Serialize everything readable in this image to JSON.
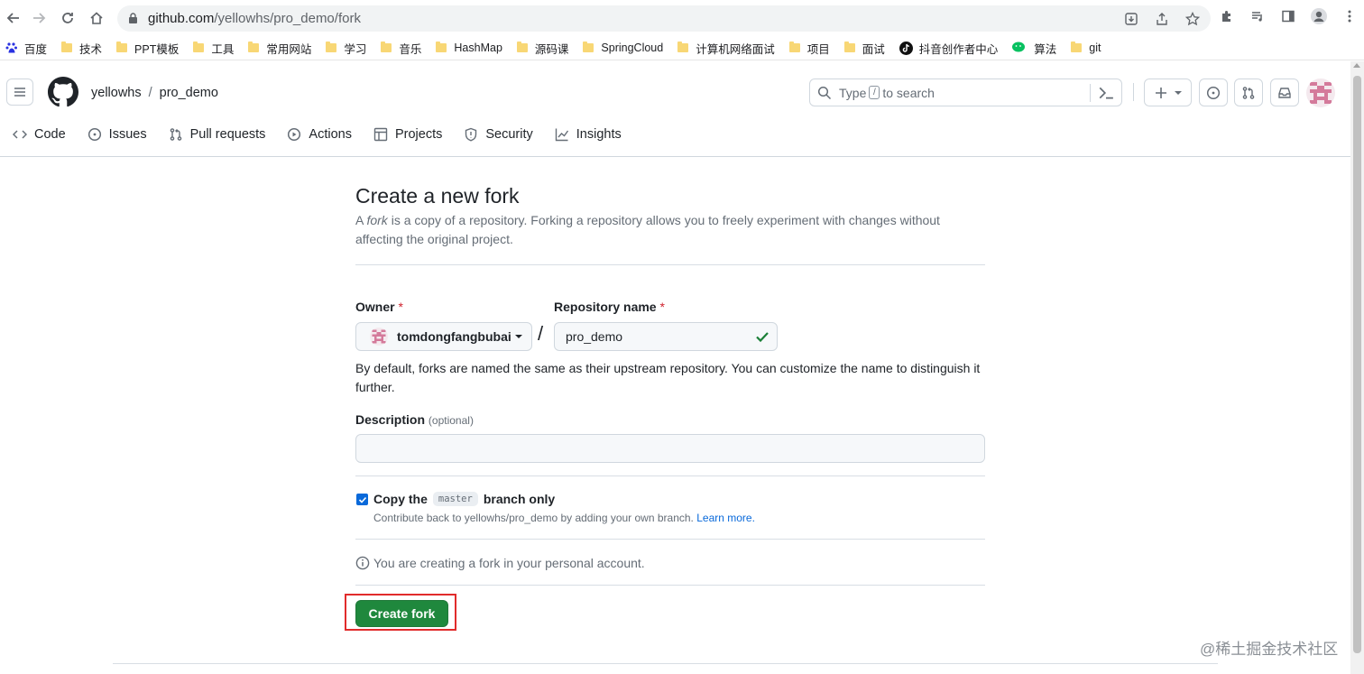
{
  "browser": {
    "url_host": "github.com",
    "url_path": "/yellowhs/pro_demo/fork",
    "bookmarks": [
      {
        "label": "百度",
        "icon": "baidu-icon"
      },
      {
        "label": "技术",
        "icon": "folder-icon"
      },
      {
        "label": "PPT模板",
        "icon": "folder-icon"
      },
      {
        "label": "工具",
        "icon": "folder-icon"
      },
      {
        "label": "常用网站",
        "icon": "folder-icon"
      },
      {
        "label": "学习",
        "icon": "folder-icon"
      },
      {
        "label": "音乐",
        "icon": "folder-icon"
      },
      {
        "label": "HashMap",
        "icon": "folder-icon"
      },
      {
        "label": "源码课",
        "icon": "folder-icon"
      },
      {
        "label": "SpringCloud",
        "icon": "folder-icon"
      },
      {
        "label": "计算机网络面试",
        "icon": "folder-icon"
      },
      {
        "label": "项目",
        "icon": "folder-icon"
      },
      {
        "label": "面试",
        "icon": "folder-icon"
      },
      {
        "label": "抖音创作者中心",
        "icon": "tiktok-icon"
      },
      {
        "label": "算法",
        "icon": "wechat-icon"
      },
      {
        "label": "git",
        "icon": "folder-icon"
      }
    ]
  },
  "header": {
    "owner": "yellowhs",
    "separator": "/",
    "repo": "pro_demo",
    "search_prefix": "Type",
    "search_key": "/",
    "search_suffix": "to search"
  },
  "repo_nav": [
    {
      "label": "Code",
      "icon": "code-icon"
    },
    {
      "label": "Issues",
      "icon": "issue-icon"
    },
    {
      "label": "Pull requests",
      "icon": "pull-request-icon"
    },
    {
      "label": "Actions",
      "icon": "play-icon"
    },
    {
      "label": "Projects",
      "icon": "table-icon"
    },
    {
      "label": "Security",
      "icon": "shield-icon"
    },
    {
      "label": "Insights",
      "icon": "graph-icon"
    }
  ],
  "form": {
    "title": "Create a new fork",
    "subtitle_a": "A",
    "subtitle_fork": "fork",
    "subtitle_rest": "is a copy of a repository. Forking a repository allows you to freely experiment with changes without affecting the original project.",
    "owner_label": "Owner",
    "required_mark": "*",
    "owner_value": "tomdongfangbubai",
    "slash": "/",
    "repo_label": "Repository name",
    "repo_value": "pro_demo",
    "name_help": "By default, forks are named the same as their upstream repository. You can customize the name to distinguish it further.",
    "description_label": "Description",
    "description_optional": "(optional)",
    "description_value": "",
    "copy_prefix": "Copy the",
    "copy_branch": "master",
    "copy_suffix": "branch only",
    "copy_checked": true,
    "copy_help": "Contribute back to yellowhs/pro_demo by adding your own branch.",
    "learn_more": "Learn more.",
    "info_text": "You are creating a fork in your personal account.",
    "submit_label": "Create fork"
  },
  "watermark": "@稀土掘金技术社区",
  "colors": {
    "primary_button": "#1f883d",
    "link": "#0969da",
    "required": "#cf222e",
    "highlight": "#e12b2b"
  }
}
